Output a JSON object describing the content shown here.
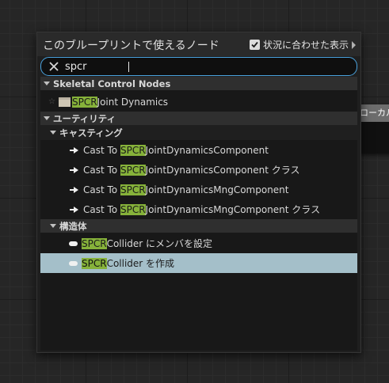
{
  "background_node": {
    "label": "ローカル"
  },
  "panel": {
    "title": "このブループリントで使えるノード",
    "context_sensitive_label": "状況に合わせた表示",
    "context_sensitive_checked": true
  },
  "search": {
    "value": "spcr"
  },
  "highlight": "SPCR",
  "categories": {
    "skeletal": {
      "label": "Skeletal Control Nodes"
    },
    "utility": {
      "label": "ユーティリティ"
    },
    "casting": {
      "label": "キャスティング"
    },
    "struct": {
      "label": "構造体"
    }
  },
  "items": {
    "joint_dynamics": {
      "pre": "",
      "match": "SPCR",
      "post": " Joint Dynamics"
    },
    "cast1": {
      "pre": "Cast To ",
      "match": "SPCR",
      "post": "JointDynamicsComponent"
    },
    "cast2": {
      "pre": "Cast To ",
      "match": "SPCR",
      "post": "JointDynamicsComponent クラス"
    },
    "cast3": {
      "pre": "Cast To ",
      "match": "SPCR",
      "post": "JointDynamicsMngComponent"
    },
    "cast4": {
      "pre": "Cast To ",
      "match": "SPCR",
      "post": "JointDynamicsMngComponent クラス"
    },
    "set_members": {
      "pre": "",
      "match": "SPCR",
      "post": "Collider にメンバを設定"
    },
    "make": {
      "pre": "",
      "match": "SPCR",
      "post": "Collider を作成"
    }
  },
  "colors": {
    "accent_border": "#4aa3df",
    "highlight": "#86b23a",
    "selection": "#a4bfc9"
  }
}
